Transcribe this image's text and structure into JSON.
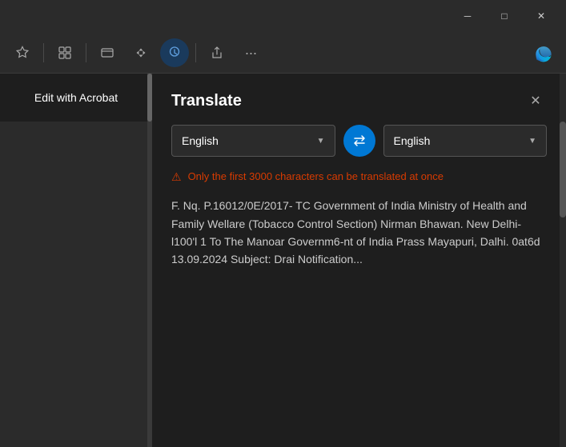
{
  "titlebar": {
    "minimize_label": "─",
    "maximize_label": "□",
    "close_label": "✕"
  },
  "toolbar": {
    "icons": [
      {
        "name": "favorites-icon",
        "symbol": "☆"
      },
      {
        "name": "collections-icon",
        "symbol": "🧩"
      },
      {
        "name": "tab-groups-icon",
        "symbol": "⬜"
      },
      {
        "name": "split-screen-icon",
        "symbol": "⭐"
      },
      {
        "name": "browser-essentials-icon",
        "symbol": "🛡"
      },
      {
        "name": "share-icon",
        "symbol": "↗"
      },
      {
        "name": "more-tools-icon",
        "symbol": "•••"
      },
      {
        "name": "edge-logo-icon",
        "symbol": "edge"
      }
    ]
  },
  "sidebar": {
    "acrobat_button_label": "Edit with Acrobat"
  },
  "translate_panel": {
    "title": "Translate",
    "source_language": "English",
    "target_language": "English",
    "warning_text": "Only the first 3000 characters can be translated at once",
    "translated_text": "F. Nq. P.16012/0E/2017- TC Government of India Ministry of Health and Family Wellare (Tobacco Control Section) Nirman Bhawan. New Delhi-l100'l 1 To The Manoar Governm6-nt of India Prass Mayapuri, Dalhi. 0at6d 13.09.2024 Subject: Drai Notification..."
  }
}
